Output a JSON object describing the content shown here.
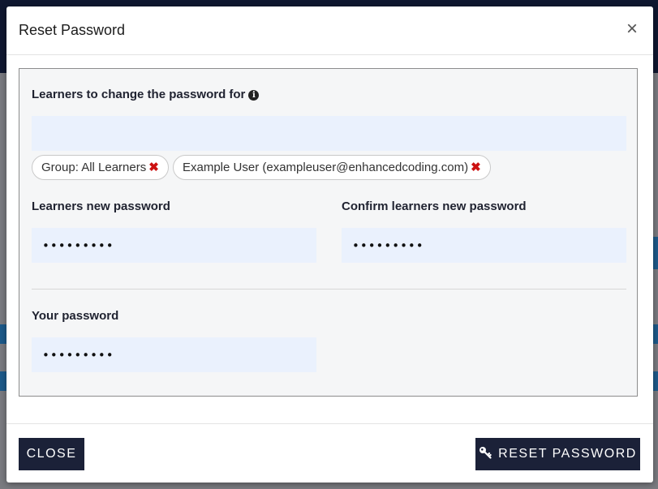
{
  "modal": {
    "title": "Reset Password",
    "close_glyph": "×"
  },
  "form": {
    "learners_label": "Learners to change the password for",
    "learners_search_value": "",
    "info_icon": "info-circle-icon",
    "selected_learners": [
      {
        "label": "Group: All Learners"
      },
      {
        "label": "Example User (exampleuser@enhancedcoding.com)"
      }
    ],
    "remove_glyph": "✖",
    "new_password_label": "Learners new password",
    "new_password_value": "•••••••••",
    "confirm_password_label": "Confirm learners new password",
    "confirm_password_value": "•••••••••",
    "your_password_label": "Your password",
    "your_password_value": "•••••••••"
  },
  "footer": {
    "close_label": "CLOSE",
    "reset_label": "RESET PASSWORD",
    "reset_icon": "key-icon"
  },
  "colors": {
    "primary": "#1b2138",
    "field_bg": "#eaf1fd",
    "remove_red": "#cc1111"
  }
}
